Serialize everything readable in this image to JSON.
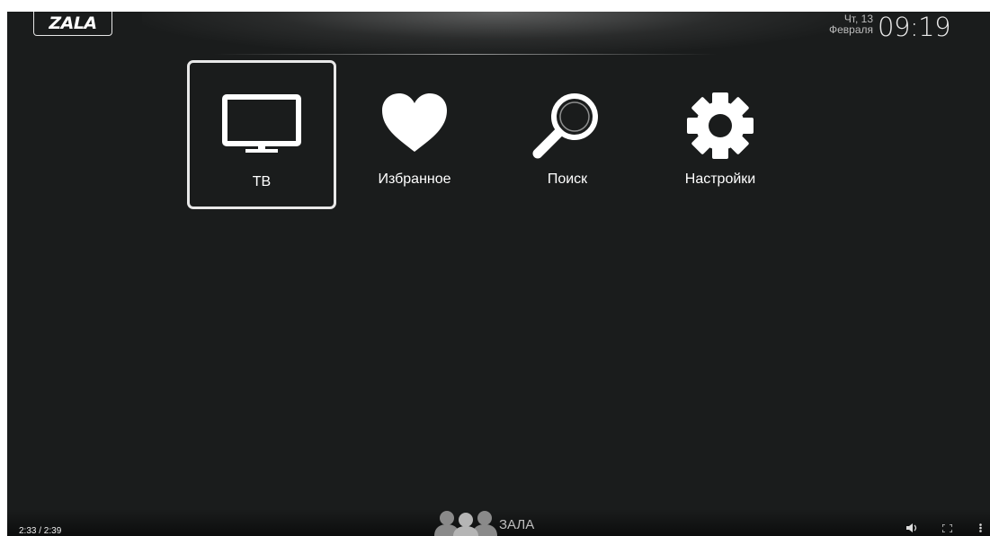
{
  "header": {
    "logo_text": "ZALA",
    "date_line1": "Чт, 13",
    "date_line2": "Февраля",
    "time": "09:19"
  },
  "menu": {
    "items": [
      {
        "label": "ТВ",
        "icon": "tv-icon",
        "selected": true
      },
      {
        "label": "Избранное",
        "icon": "heart-icon",
        "selected": false
      },
      {
        "label": "Поиск",
        "icon": "search-icon",
        "selected": false
      },
      {
        "label": "Настройки",
        "icon": "gear-icon",
        "selected": false
      }
    ]
  },
  "footer": {
    "brand_text": "ЗАЛА",
    "brand_icon": "people-icon"
  },
  "player": {
    "time_display": "2:33 / 2:39",
    "volume_icon": "volume-icon",
    "fullscreen_icon": "fullscreen-icon",
    "more_icon": "more-vertical-icon"
  },
  "colors": {
    "background": "#1a1c1c",
    "text": "#ffffff",
    "selection_border": "#e8e8e8"
  }
}
